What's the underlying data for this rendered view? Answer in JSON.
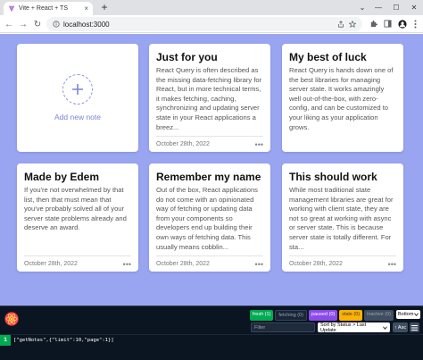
{
  "browser": {
    "tab_title": "Vite + React + TS",
    "tab_close": "×",
    "new_tab": "+",
    "window_controls": [
      "⌄",
      "—",
      "☐",
      "✕"
    ],
    "url": "localhost:3000",
    "nav": [
      "←",
      "→",
      "↻"
    ]
  },
  "app": {
    "background_color": "#9aa5f2",
    "add_note_label": "Add new note",
    "notes": [
      {
        "title": "Just for you",
        "body": "React Query is often described as the missing data-fetching library for React, but in more technical terms, it makes fetching, caching, synchronizing and updating server state in your React applications a breez...",
        "date": "October 28th, 2022"
      },
      {
        "title": "My best of luck",
        "body": "React Query is hands down one of the best libraries for managing server state. It works amazingly well out-of-the-box, with zero-config, and can be customized to your liking as your application grows.",
        "date": "October 28th, 2022"
      },
      {
        "title": "Made by Edem",
        "body": "If you're not overwhelmed by that list, then that must mean that you've probably solved all of your server state problems already and deserve an award.",
        "date": "October 28th, 2022"
      },
      {
        "title": "Remember my name",
        "body": "Out of the box, React applications do not come with an opinionated way of fetching or updating data from your components so developers end up building their own ways of fetching data. This usually means cobblin...",
        "date": "October 28th, 2022"
      },
      {
        "title": "This should work",
        "body": "While most traditional state management libraries are great for working with client state, they are not so great at working with async or server state. This is because server state is totally different. For sta...",
        "date": "October 28th, 2022"
      }
    ],
    "menu_glyph": "•••"
  },
  "devtools": {
    "pills": {
      "fresh": "fresh (1)",
      "fetching": "fetching (0)",
      "paused": "paused (0)",
      "stale": "stale (0)",
      "inactive": "inactive (0)"
    },
    "position": "Bottom",
    "filter_placeholder": "Filter",
    "sort_label": "Sort by Status > Last Update",
    "asc_label": "↑ Asc",
    "query_observer_count": "1",
    "query_key": "[\"getNotes\",{\"limit\":10,\"page\":1}]"
  }
}
